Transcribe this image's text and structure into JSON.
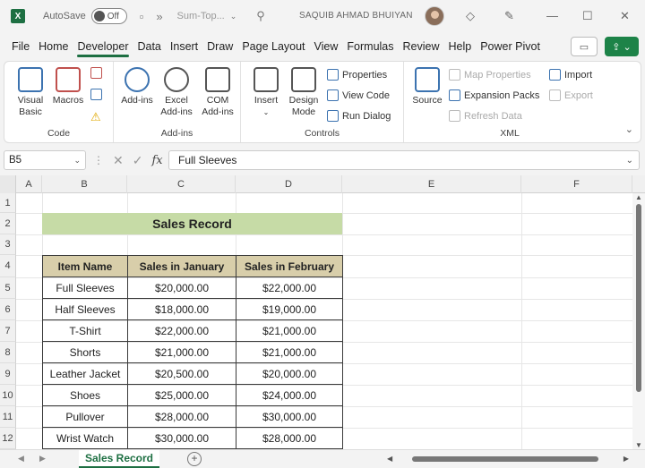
{
  "title_bar": {
    "autosave_label": "AutoSave",
    "autosave_state": "Off",
    "doc_title": "Sum-Top...",
    "user_name": "SAQUIB AHMAD BHUIYAN"
  },
  "menu": {
    "tabs": [
      "File",
      "Home",
      "Developer",
      "Data",
      "Insert",
      "Draw",
      "Page Layout",
      "View",
      "Formulas",
      "Review",
      "Help",
      "Power Pivot"
    ],
    "active": "Developer"
  },
  "ribbon": {
    "code": {
      "label": "Code",
      "visual_basic": "Visual Basic",
      "macros": "Macros"
    },
    "addins": {
      "label": "Add-ins",
      "addins": "Add-ins",
      "excel_addins": "Excel Add-ins",
      "com_addins": "COM Add-ins"
    },
    "controls": {
      "label": "Controls",
      "insert": "Insert",
      "design_mode": "Design Mode",
      "properties": "Properties",
      "view_code": "View Code",
      "run_dialog": "Run Dialog"
    },
    "xml": {
      "label": "XML",
      "source": "Source",
      "map_properties": "Map Properties",
      "expansion_packs": "Expansion Packs",
      "refresh_data": "Refresh Data",
      "import": "Import",
      "export": "Export"
    }
  },
  "formula_bar": {
    "name_box": "B5",
    "fx": "fx",
    "value": "Full Sleeves"
  },
  "sheet": {
    "columns": [
      "A",
      "B",
      "C",
      "D",
      "E",
      "F"
    ],
    "rows": [
      "1",
      "2",
      "3",
      "4",
      "5",
      "6",
      "7",
      "8",
      "9",
      "10",
      "11",
      "12"
    ],
    "title": "Sales Record",
    "headers": [
      "Item Name",
      "Sales in January",
      "Sales in February"
    ],
    "data": [
      [
        "Full Sleeves",
        "$20,000.00",
        "$22,000.00"
      ],
      [
        "Half Sleeves",
        "$18,000.00",
        "$19,000.00"
      ],
      [
        "T-Shirt",
        "$22,000.00",
        "$21,000.00"
      ],
      [
        "Shorts",
        "$21,000.00",
        "$21,000.00"
      ],
      [
        "Leather Jacket",
        "$20,500.00",
        "$20,000.00"
      ],
      [
        "Shoes",
        "$25,000.00",
        "$24,000.00"
      ],
      [
        "Pullover",
        "$28,000.00",
        "$30,000.00"
      ],
      [
        "Wrist Watch",
        "$30,000.00",
        "$28,000.00"
      ]
    ]
  },
  "sheet_tabs": {
    "active": "Sales Record"
  },
  "colors": {
    "accent": "#1d6f42",
    "title_fill": "#c6dba6",
    "header_fill": "#d8ceaa"
  }
}
